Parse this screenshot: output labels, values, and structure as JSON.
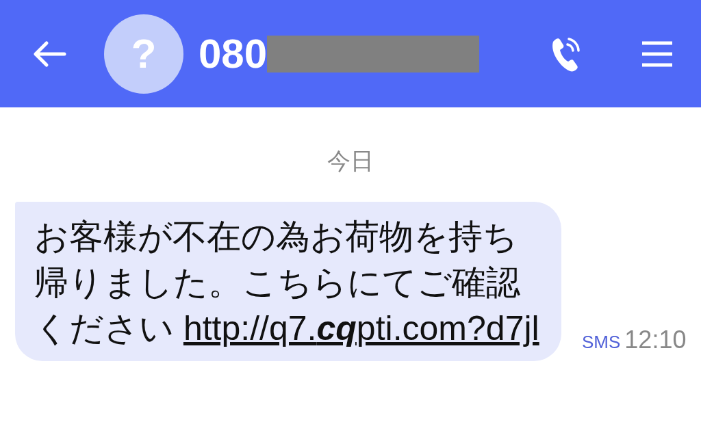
{
  "header": {
    "avatar_glyph": "?",
    "phone_number": "080"
  },
  "date_label": "今日",
  "messages": [
    {
      "text": "お客様が不在の為お荷物を持ち帰りました。こちらにてご確認ください",
      "link": "http://q7.**cq**pti.com?d7jl",
      "channel": "SMS",
      "time": "12:10"
    }
  ]
}
